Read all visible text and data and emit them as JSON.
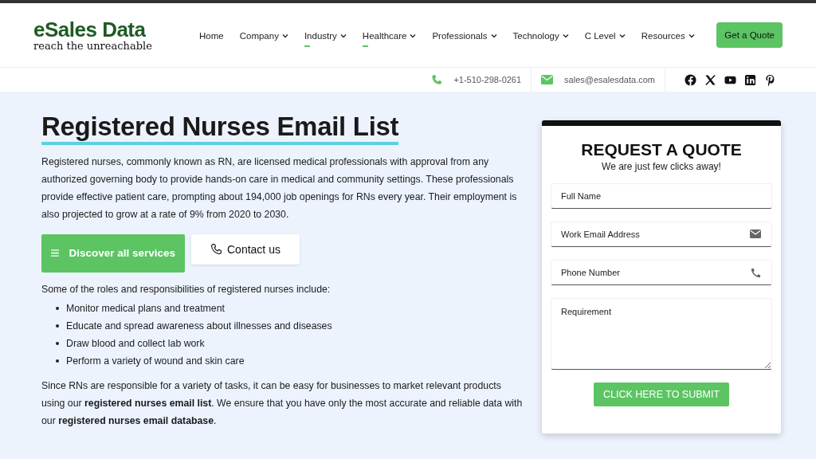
{
  "logo": {
    "name": "eSales Data",
    "tagline": "reach the unreachable"
  },
  "nav": [
    {
      "label": "Home",
      "dropdown": false,
      "selected": false
    },
    {
      "label": "Company",
      "dropdown": true,
      "selected": false
    },
    {
      "label": "Industry",
      "dropdown": true,
      "selected": true
    },
    {
      "label": "Healthcare",
      "dropdown": true,
      "selected": true
    },
    {
      "label": "Professionals",
      "dropdown": true,
      "selected": false
    },
    {
      "label": "Technology",
      "dropdown": true,
      "selected": false
    },
    {
      "label": "C Level",
      "dropdown": true,
      "selected": false
    },
    {
      "label": "Resources",
      "dropdown": true,
      "selected": false
    }
  ],
  "cta": "Get a Quote",
  "contact": {
    "phone": "+1-510-298-0261",
    "email": "sales@esalesdata.com"
  },
  "title": "Registered Nurses Email List",
  "intro": "Registered nurses, commonly known as RN, are licensed medical professionals with approval from any authorized governing body to provide hands-on care in medical and community settings. These professionals provide effective patient care, prompting about 194,000 job openings for RNs every year. Their employment is also projected to grow at a rate of 9% from 2020 to 2030.",
  "buttons": {
    "services": "Discover all services",
    "contact": "Contact us"
  },
  "roles_intro": "Some of the roles and responsibilities of registered nurses include:",
  "roles": [
    "Monitor medical plans and treatment",
    "Educate and spread awareness about illnesses and diseases",
    "Draw blood and collect lab work",
    "Perform a variety of wound and skin care"
  ],
  "closing": "Since RNs are responsible for a variety of tasks, it can be easy for businesses to market relevant products using our **registered nurses email list**. We ensure that you have only the most accurate and reliable data with our **registered nurses email database**.",
  "quote_form": {
    "title": "REQUEST A QUOTE",
    "subtitle": "We are just few clicks away!",
    "fields": [
      {
        "kind": "text",
        "placeholder": "Full Name"
      },
      {
        "kind": "email",
        "placeholder": "Work Email Address"
      },
      {
        "kind": "phone",
        "placeholder": "Phone Number"
      },
      {
        "kind": "textarea",
        "placeholder": "Requirement"
      }
    ],
    "submit": "CLICK HERE TO SUBMIT"
  }
}
